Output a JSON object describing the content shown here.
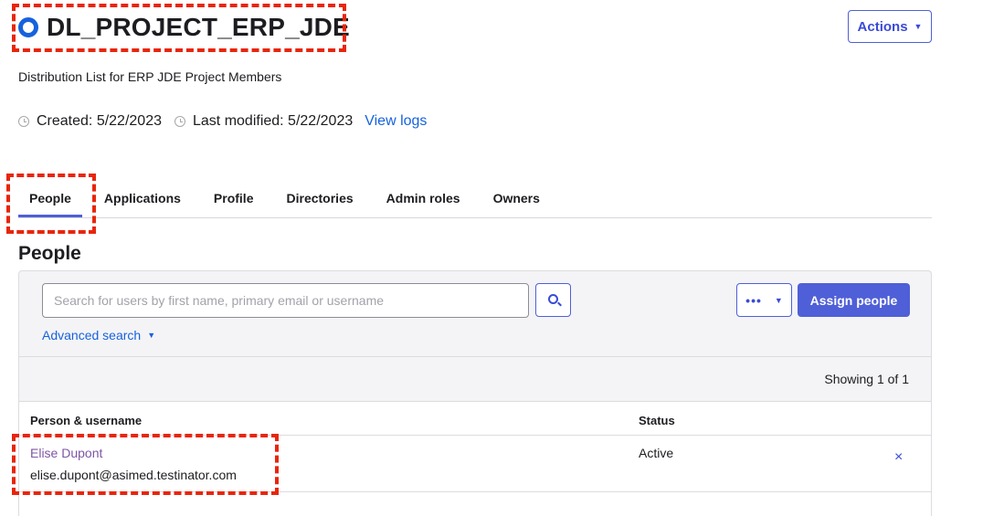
{
  "group": {
    "name": "DL_PROJECT_ERP_JDE",
    "description": "Distribution List for ERP JDE Project Members",
    "created": "Created: 5/22/2023",
    "last_modified": "Last modified: 5/22/2023",
    "view_logs": "View logs"
  },
  "header": {
    "actions_label": "Actions",
    "actions_caret": "▼"
  },
  "tabs": [
    {
      "label": "People",
      "active": true
    },
    {
      "label": "Applications"
    },
    {
      "label": "Profile"
    },
    {
      "label": "Directories"
    },
    {
      "label": "Admin roles"
    },
    {
      "label": "Owners"
    }
  ],
  "people_section": {
    "title": "People",
    "search_placeholder": "Search for users by first name, primary email or username",
    "more_dots": "•••",
    "more_caret": "▼",
    "assign_label": "Assign people",
    "advanced_search": "Advanced search",
    "advanced_caret": "▼",
    "showing": "Showing 1 of 1",
    "columns": [
      "Person & username",
      "Status"
    ],
    "rows": [
      {
        "name": "Elise Dupont",
        "username": "elise.dupont@asimed.testinator.com",
        "status": "Active",
        "remove": "×"
      }
    ]
  },
  "colors": {
    "accent": "#4f5fd8",
    "link": "#1662dd",
    "highlight": "#e8250c",
    "person_link": "#7e56a4"
  },
  "icons": [
    "group-icon",
    "clock-icon",
    "search-icon",
    "more-icon",
    "remove-icon"
  ]
}
